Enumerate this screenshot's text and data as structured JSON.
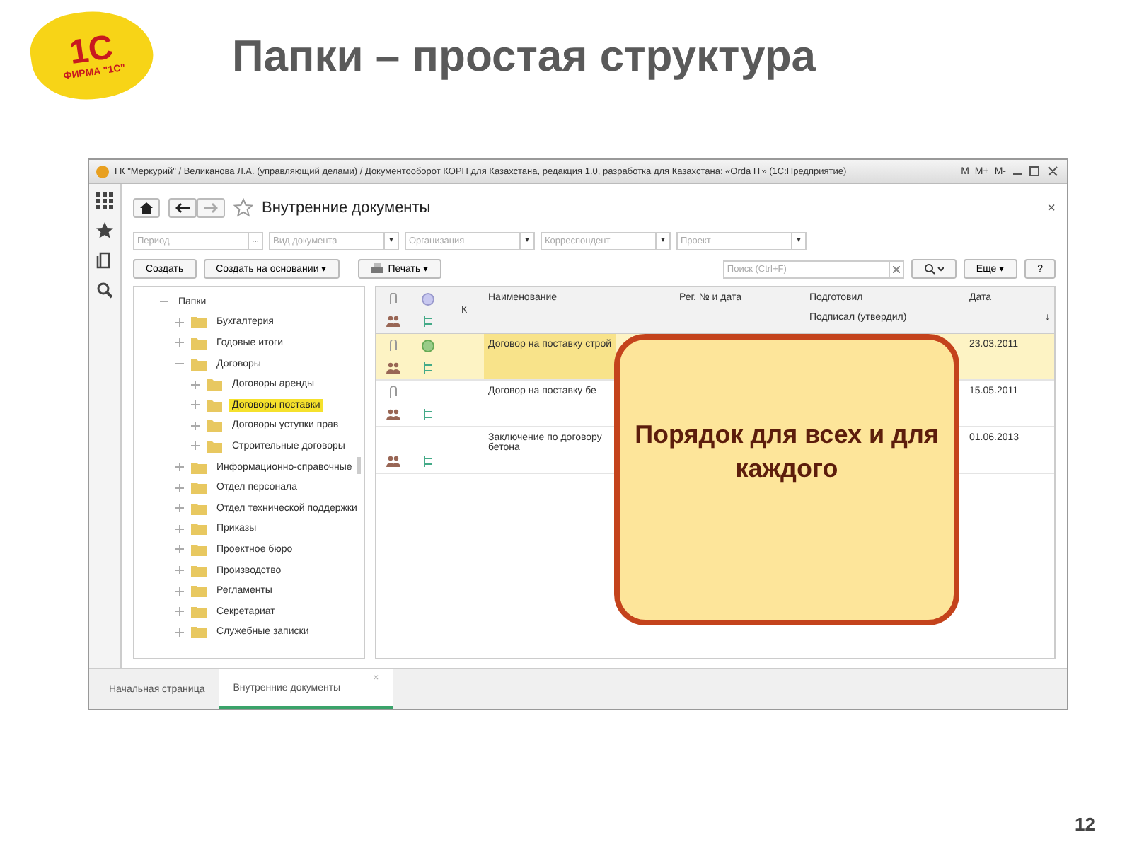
{
  "logo": {
    "mark": "1С",
    "caption": "ФИРМА \"1С\""
  },
  "slide_title": "Папки – простая структура",
  "window": {
    "title": "ГК \"Меркурий\" / Великанова Л.А. (управляющий делами) / Документооборот КОРП для Казахстана, редакция 1.0, разработка для Казахстана: «Orda IT» (1С:Предприятие)",
    "memory_buttons": [
      "M",
      "M+",
      "M-"
    ]
  },
  "form": {
    "title": "Внутренние документы",
    "close": "×"
  },
  "filters": [
    {
      "placeholder": "Период",
      "button": "..."
    },
    {
      "placeholder": "Вид документа",
      "button": "▾"
    },
    {
      "placeholder": "Организация",
      "button": "▾"
    },
    {
      "placeholder": "Корреспондент",
      "button": "▾"
    },
    {
      "placeholder": "Проект",
      "button": "▾"
    }
  ],
  "commands": {
    "create": "Создать",
    "create_based": "Создать на основании",
    "print": "Печать",
    "search_placeholder": "Поиск (Ctrl+F)",
    "more": "Еще",
    "help": "?",
    "caret": "▾"
  },
  "tree": [
    {
      "label": "Папки",
      "expanded": true,
      "selected": false,
      "children": [
        {
          "label": "Бухгалтерия",
          "expanded": false,
          "selected": false
        },
        {
          "label": "Годовые итоги",
          "expanded": false,
          "selected": false
        },
        {
          "label": "Договоры",
          "expanded": true,
          "selected": false,
          "children": [
            {
              "label": "Договоры аренды",
              "expanded": false,
              "selected": false
            },
            {
              "label": "Договоры поставки",
              "expanded": false,
              "selected": true
            },
            {
              "label": "Договоры уступки прав",
              "expanded": false,
              "selected": false
            },
            {
              "label": "Строительные договоры",
              "expanded": false,
              "selected": false
            }
          ]
        },
        {
          "label": "Информационно-справочные",
          "expanded": false,
          "selected": false
        },
        {
          "label": "Отдел персонала",
          "expanded": false,
          "selected": false
        },
        {
          "label": "Отдел технической поддержки",
          "expanded": false,
          "selected": false
        },
        {
          "label": "Приказы",
          "expanded": false,
          "selected": false
        },
        {
          "label": "Проектное бюро",
          "expanded": false,
          "selected": false
        },
        {
          "label": "Производство",
          "expanded": false,
          "selected": false
        },
        {
          "label": "Регламенты",
          "expanded": false,
          "selected": false
        },
        {
          "label": "Секретариат",
          "expanded": false,
          "selected": false
        },
        {
          "label": "Служебные записки",
          "expanded": false,
          "selected": false
        }
      ]
    }
  ],
  "table": {
    "columns": {
      "k": "К",
      "name": "Наименование",
      "reg": "Рег. № и дата",
      "prepared": "Подготовил",
      "signed": "Подписал (утвердил)",
      "date": "Дата",
      "sort": "↓"
    },
    "rows": [
      {
        "selected": true,
        "approved": true,
        "attachment": true,
        "name": [
          "Договор на поставку строй"
        ],
        "date": "23.03.2011"
      },
      {
        "selected": false,
        "approved": false,
        "attachment": true,
        "name": [
          "Договор на поставку бе"
        ],
        "date": "15.05.2011"
      },
      {
        "selected": false,
        "approved": false,
        "attachment": false,
        "name": [
          "Заключение по договору",
          "бетона"
        ],
        "date": "01.06.2013"
      }
    ]
  },
  "callout": "Порядок для всех и для каждого",
  "bottom_tabs": [
    {
      "label": "Начальная страница",
      "selected": false
    },
    {
      "label": "Внутренние документы",
      "selected": true,
      "close": "×"
    }
  ],
  "slide_number": "12"
}
